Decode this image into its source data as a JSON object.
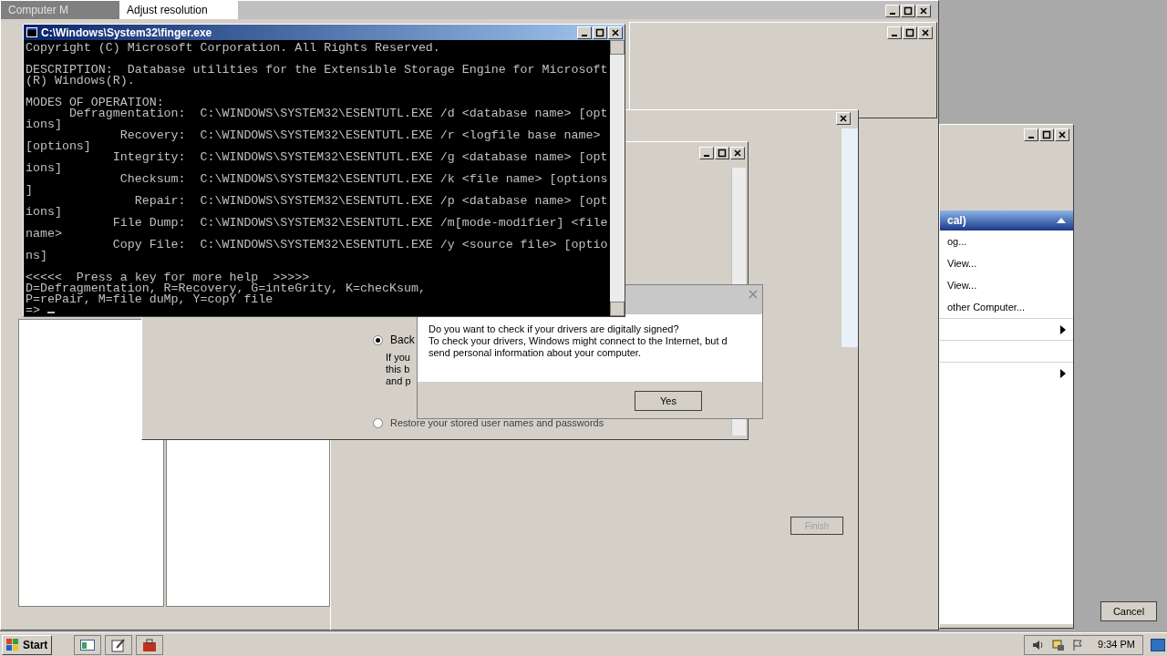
{
  "tabs": [
    {
      "label": "Computer M",
      "selected": false
    },
    {
      "label": "Adjust resolution",
      "selected": true
    }
  ],
  "console": {
    "title": "C:\\Windows\\System32\\finger.exe",
    "paragraphs": [
      [
        "Copyright (C) Microsoft Corporation. All Rights Reserved."
      ],
      [
        "DESCRIPTION:  Database utilities for the Extensible Storage Engine for Microsoft",
        "(R) Windows(R)."
      ],
      [
        "MODES OF OPERATION:",
        "      Defragmentation:  C:\\WINDOWS\\SYSTEM32\\ESENTUTL.EXE /d <database name> [opt",
        "ions]",
        "             Recovery:  C:\\WINDOWS\\SYSTEM32\\ESENTUTL.EXE /r <logfile base name>",
        "[options]",
        "            Integrity:  C:\\WINDOWS\\SYSTEM32\\ESENTUTL.EXE /g <database name> [opt",
        "ions]",
        "             Checksum:  C:\\WINDOWS\\SYSTEM32\\ESENTUTL.EXE /k <file name> [options",
        "]",
        "               Repair:  C:\\WINDOWS\\SYSTEM32\\ESENTUTL.EXE /p <database name> [opt",
        "ions]",
        "            File Dump:  C:\\WINDOWS\\SYSTEM32\\ESENTUTL.EXE /m[mode-modifier] <file",
        "name>",
        "            Copy File:  C:\\WINDOWS\\SYSTEM32\\ESENTUTL.EXE /y <source file> [optio",
        "ns]"
      ],
      [
        "<<<<<  Press a key for more help  >>>>>",
        "D=Defragmentation, R=Recovery, G=inteGrity, K=checKsum,",
        "P=rePair, M=file duMp, Y=copY file",
        "=>"
      ]
    ]
  },
  "backup_page": {
    "options": [
      {
        "label": "Back",
        "selected": true
      },
      {
        "label": "Restore your stored user names and passwords",
        "selected": false
      }
    ],
    "description_lines": [
      "If you",
      "this b",
      "and p"
    ]
  },
  "dialog": {
    "lines": [
      "Do you want to check if your drivers are digitally signed?",
      "To check your drivers, Windows might connect to the Internet, but d",
      "send personal information about your computer."
    ],
    "yes": "Yes"
  },
  "actions": {
    "header": "cal)",
    "items": [
      {
        "kind": "link",
        "label": "og..."
      },
      {
        "kind": "link",
        "label": "View..."
      },
      {
        "kind": "link",
        "label": "View..."
      },
      {
        "kind": "link",
        "label": "other Computer..."
      },
      {
        "kind": "submenu"
      },
      {
        "kind": "blank"
      },
      {
        "kind": "submenu"
      }
    ]
  },
  "wizard": {
    "finish": {
      "label": "Finish",
      "disabled": true
    },
    "cancel": "Cancel"
  },
  "taskbar": {
    "start": "Start",
    "clock": "9:34 PM"
  }
}
